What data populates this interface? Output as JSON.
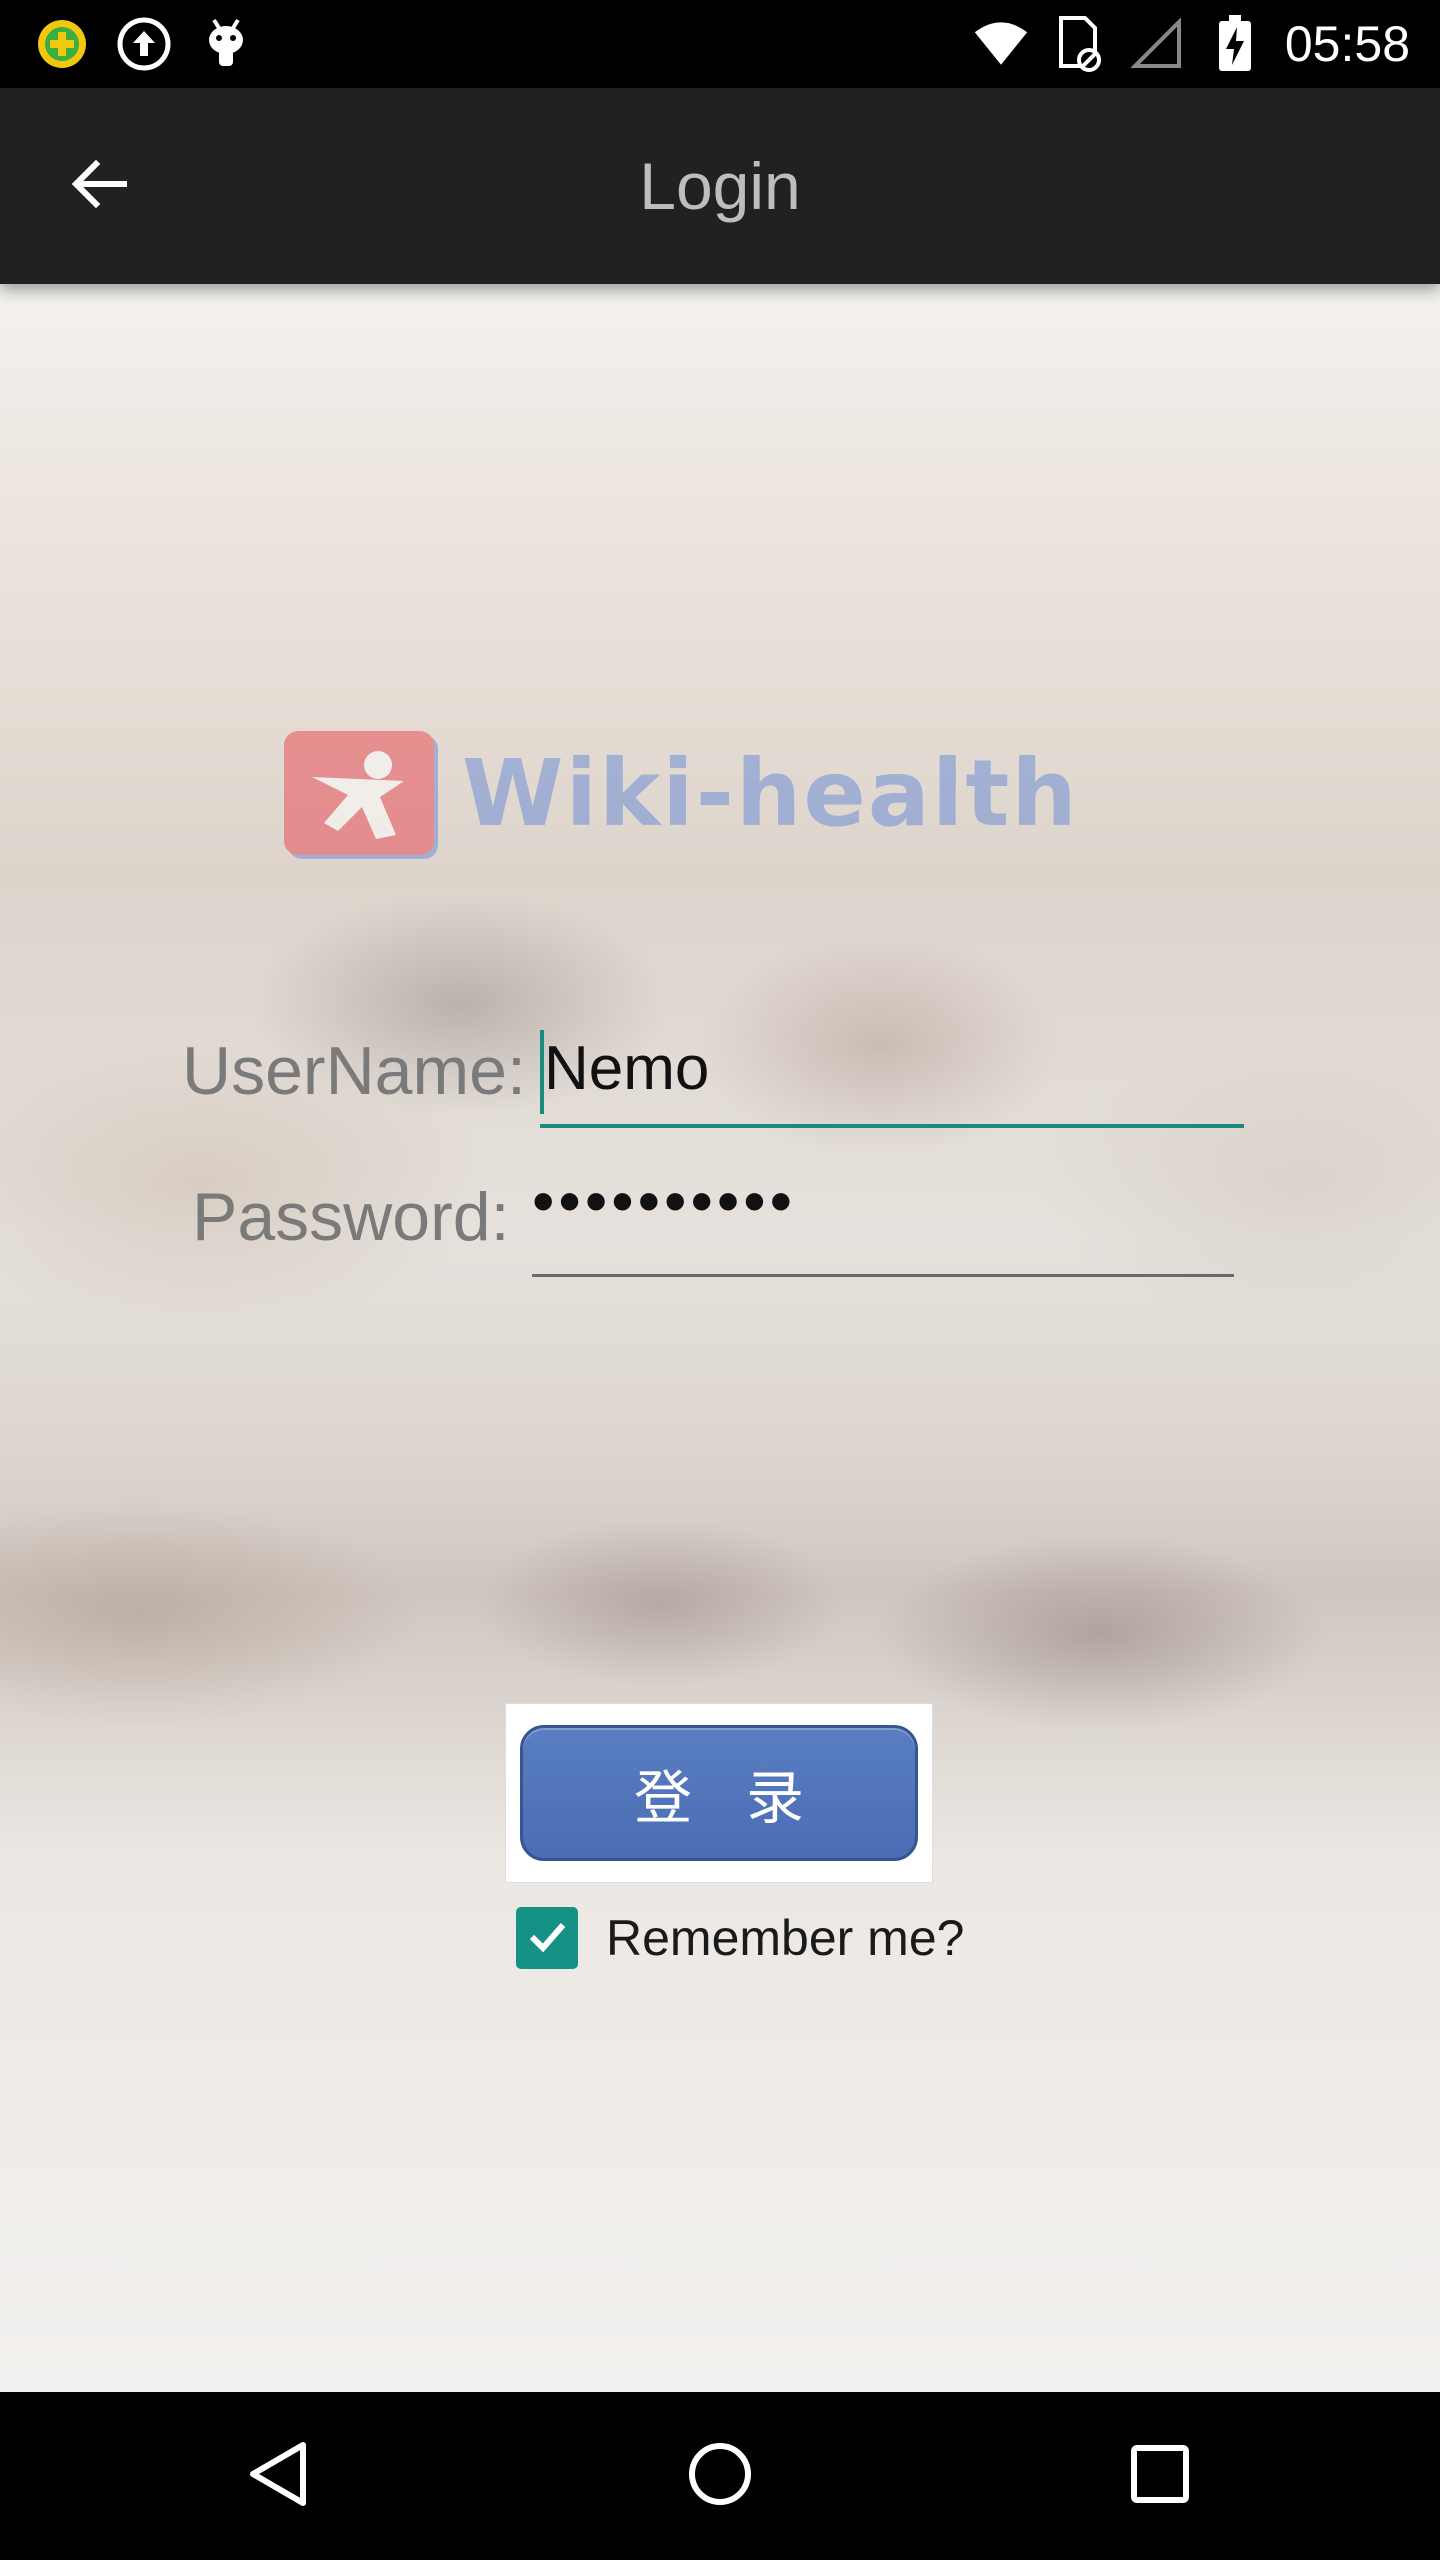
{
  "status_bar": {
    "time": "05:58",
    "left_icons": [
      "app-plus-badge-icon",
      "upload-arrow-icon",
      "android-debug-icon"
    ],
    "right_icons": [
      "wifi-icon",
      "sim-card-off-icon",
      "cell-signal-icon",
      "battery-charging-icon"
    ]
  },
  "app_bar": {
    "title": "Login",
    "back_icon": "arrow-back-icon"
  },
  "logo": {
    "text": "Wiki-health"
  },
  "form": {
    "username_label": "UserName:",
    "username_value": "Nemo",
    "password_label": "Password:",
    "password_value": "••••••••••"
  },
  "login_button": {
    "label": "登录"
  },
  "remember": {
    "label": "Remember me?",
    "checked": true
  },
  "nav_bar": {
    "icons": [
      "nav-back-icon",
      "nav-home-icon",
      "nav-recents-icon"
    ]
  },
  "colors": {
    "accent": "#159185",
    "app_bar": "#212121",
    "login_button": "#4a6db3"
  }
}
